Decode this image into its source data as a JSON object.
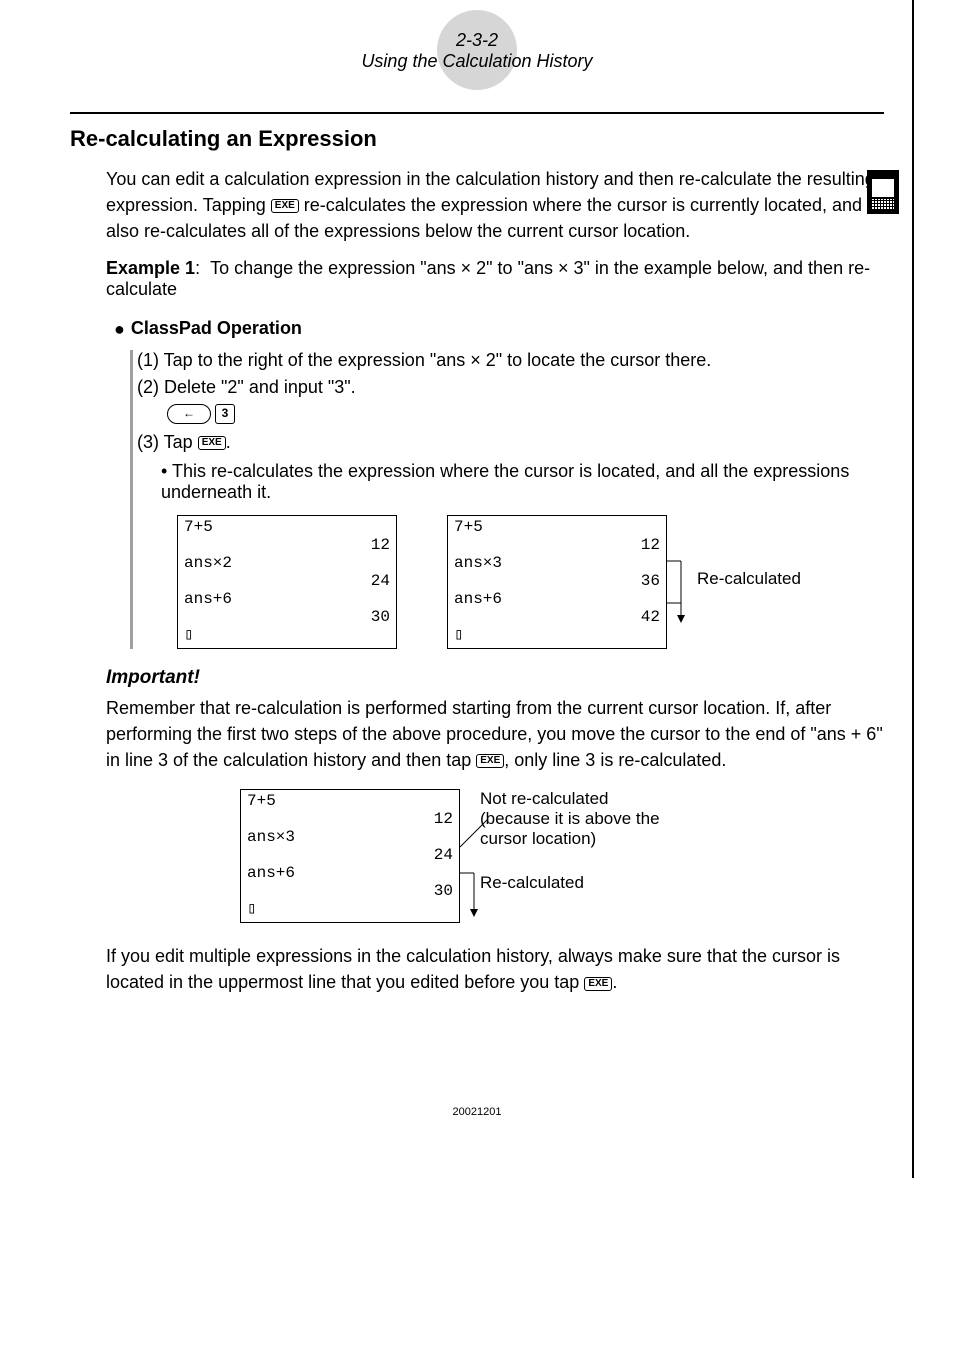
{
  "header": {
    "pagenum": "2-3-2",
    "subtitle": "Using the Calculation History"
  },
  "section_title": "Re-calculating an Expression",
  "intro_a": "You can edit a calculation expression in the calculation history and then re-calculate the resulting expression. Tapping ",
  "intro_b": " re-calculates the expression where the cursor is currently located, and also re-calculates all of the expressions below the current cursor location.",
  "example": {
    "label": "Example 1",
    "sep": ":",
    "text": "To change the expression \"ans × 2\" to \"ans × 3\" in the example below, and then re-calculate"
  },
  "op_head": "ClassPad Operation",
  "step1": "(1) Tap to the right of the expression \"ans × 2\" to locate the cursor there.",
  "step2": "(2) Delete \"2\" and input \"3\".",
  "key_back": "←",
  "key_3": "3",
  "step3_a": "(3) Tap ",
  "step3_b": ".",
  "bullet_note": "• This re-calculates the expression where the cursor is located, and all the expressions underneath it.",
  "box1": {
    "l1": "7+5",
    "r1": "12",
    "l2": "ans×2",
    "r2": "24",
    "l3": "ans+6",
    "r3": "30",
    "cur": "▯"
  },
  "box2": {
    "l1": "7+5",
    "r1": "12",
    "l2": "ans×3",
    "r2": "36",
    "l3": "ans+6",
    "r3": "42",
    "cur": "▯"
  },
  "recalc_label": "Re-calculated",
  "important_label": "Important!",
  "important_text_a": "Remember that re-calculation is performed starting from the current cursor location. If, after performing the first two steps of the above procedure, you move the cursor to the end of \"ans + 6\" in line 3 of the calculation history and then tap ",
  "important_text_b": ", only line 3 is re-calculated.",
  "box3": {
    "l1": "7+5",
    "r1": "12",
    "l2": "ans×3",
    "r2": "24",
    "l3": "ans+6",
    "r3": "30",
    "cur": "▯"
  },
  "anno_notrecalc_a": "Not re-calculated",
  "anno_notrecalc_b": "(because it is above the cursor location)",
  "closing_a": "If you edit multiple expressions in the calculation history, always make sure that the cursor is located in the uppermost line that you edited before you tap ",
  "closing_b": ".",
  "exe_label": "EXE",
  "footer_code": "20021201",
  "bullet_char": "●"
}
